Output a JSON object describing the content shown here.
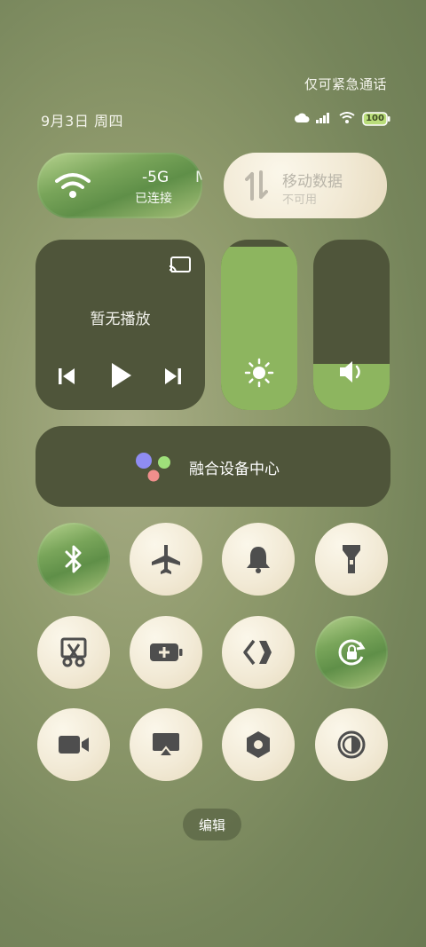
{
  "status": {
    "emergency_text": "仅可紧急通话",
    "date_text": "9月3日 周四",
    "battery_level": "100"
  },
  "tiles": {
    "wifi": {
      "network": "-5G",
      "network_partial": "MIC",
      "state": "已连接"
    },
    "mobile_data": {
      "title": "移动数据",
      "state": "不可用"
    }
  },
  "media": {
    "status": "暂无播放"
  },
  "brightness_level": 0.96,
  "volume_level": 0.27,
  "device_center": {
    "label": "融合设备中心"
  },
  "toggles": [
    {
      "name": "bluetooth",
      "active": true
    },
    {
      "name": "airplane",
      "active": false
    },
    {
      "name": "bell",
      "active": false
    },
    {
      "name": "flashlight",
      "active": false
    },
    {
      "name": "screenshot",
      "active": false
    },
    {
      "name": "battery-saver",
      "active": false
    },
    {
      "name": "nearby-share",
      "active": false
    },
    {
      "name": "rotation-lock",
      "active": true
    },
    {
      "name": "screen-record",
      "active": false
    },
    {
      "name": "screen-cast",
      "active": false
    },
    {
      "name": "settings-hex",
      "active": false
    },
    {
      "name": "dark-mode",
      "active": false
    }
  ],
  "edit_button": {
    "label": "编辑"
  },
  "colors": {
    "active_green": "#7fa85b",
    "cream": "#f4ecd9",
    "icon_dark": "#4e4e4e",
    "dark_tile": "#4f553a"
  }
}
